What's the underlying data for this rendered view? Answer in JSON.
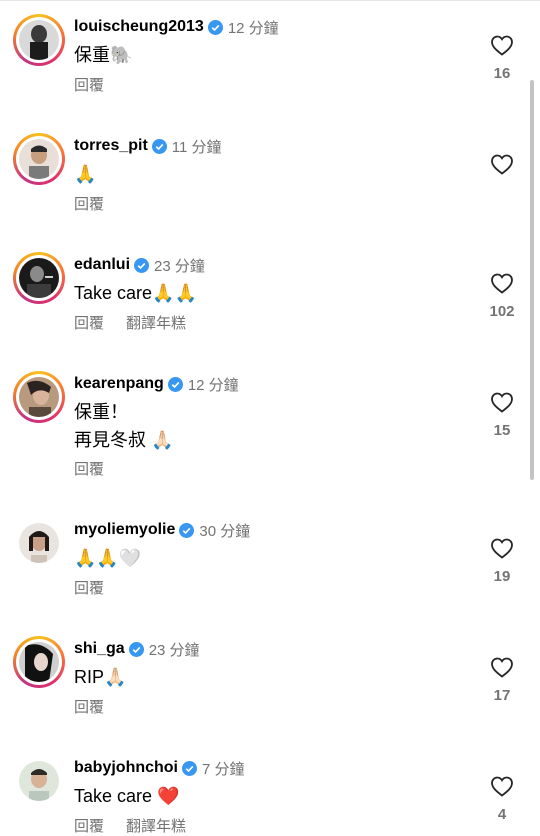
{
  "comments": [
    {
      "username": "louischeung2013",
      "time": "12 分鐘",
      "text": "保重🐘",
      "likes": "16",
      "reply": "回覆",
      "translate": ""
    },
    {
      "username": "torres_pit",
      "time": "11 分鐘",
      "text": "🙏",
      "likes": "",
      "reply": "回覆",
      "translate": ""
    },
    {
      "username": "edanlui",
      "time": "23 分鐘",
      "text": "Take care🙏🙏",
      "likes": "102",
      "reply": "回覆",
      "translate": "翻譯年糕"
    },
    {
      "username": "kearenpang",
      "time": "12 分鐘",
      "text": "保重！\n再見冬叔 🙏🏻",
      "likes": "15",
      "reply": "回覆",
      "translate": ""
    },
    {
      "username": "myoliemyolie",
      "time": "30 分鐘",
      "text": "🙏🙏🤍",
      "likes": "19",
      "reply": "回覆",
      "translate": ""
    },
    {
      "username": "shi_ga",
      "time": "23 分鐘",
      "text": "RIP🙏🏻",
      "likes": "17",
      "reply": "回覆",
      "translate": ""
    },
    {
      "username": "babyjohnchoi",
      "time": "7 分鐘",
      "text": "Take care ❤️",
      "likes": "4",
      "reply": "回覆",
      "translate": "翻譯年糕"
    }
  ],
  "icons": {
    "like": "heart-outline-icon",
    "verified": "verified-badge-icon"
  },
  "colors": {
    "verified": "#3897f0",
    "secondary": "#737373"
  }
}
